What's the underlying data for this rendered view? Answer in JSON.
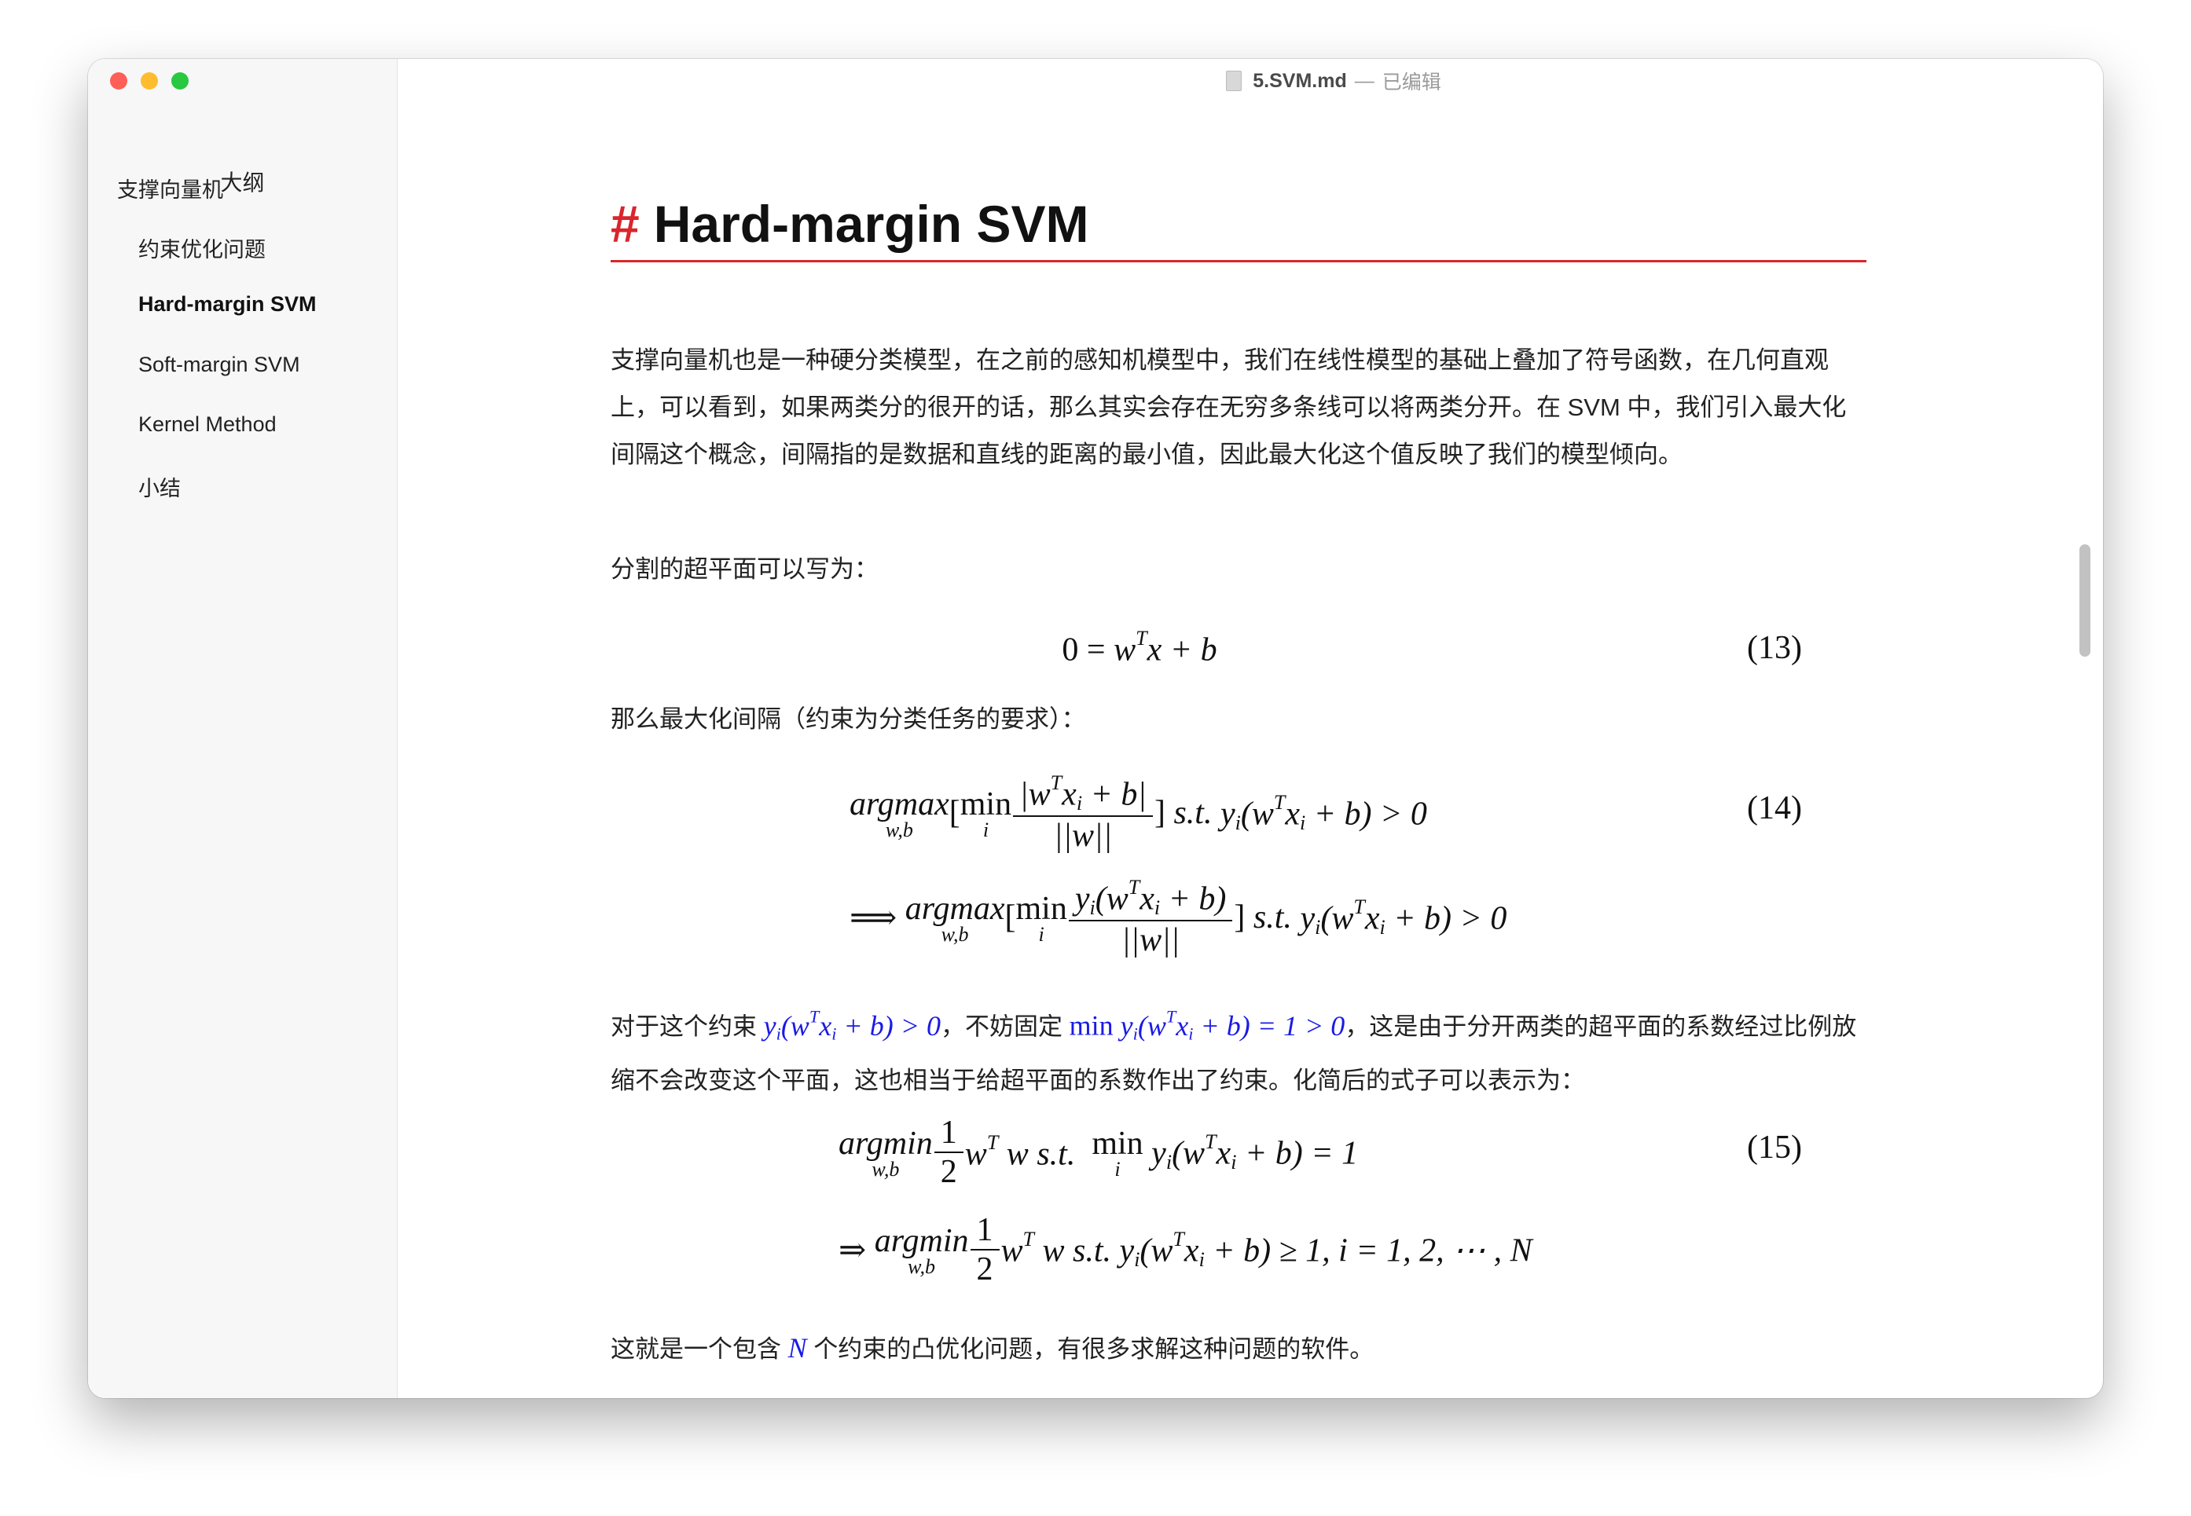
{
  "window": {
    "file_name": "5.SVM.md",
    "separator": "—",
    "status": "已编辑",
    "doc_icon": "document-icon"
  },
  "traffic_lights": {
    "close": "#fe5f57",
    "minimize": "#febc2e",
    "zoom": "#28c840"
  },
  "sidebar": {
    "title": "大纲",
    "items": [
      {
        "label": "支撑向量机",
        "level": 1,
        "active": false
      },
      {
        "label": "约束优化问题",
        "level": 2,
        "active": false
      },
      {
        "label": "Hard-margin SVM",
        "level": 2,
        "active": true
      },
      {
        "label": "Soft-margin SVM",
        "level": 2,
        "active": false
      },
      {
        "label": "Kernel Method",
        "level": 2,
        "active": false
      },
      {
        "label": "小结",
        "level": 2,
        "active": false
      }
    ]
  },
  "content": {
    "heading_hash": "#",
    "heading": "Hard-margin SVM",
    "accent_color": "#d9262c",
    "para1": "支撑向量机也是一种硬分类模型，在之前的感知机模型中，我们在线性模型的基础上叠加了符号函数，在几何直观上，可以看到，如果两类分的很开的话，那么其实会存在无穷多条线可以将两类分开。在 SVM 中，我们引入最大化间隔这个概念，间隔指的是数据和直线的距离的最小值，因此最大化这个值反映了我们的模型倾向。",
    "para2": "分割的超平面可以写为：",
    "eq13": {
      "a": "0 = ",
      "w": "w",
      "T": "T",
      "rest": "x + b",
      "num": "(13)"
    },
    "para3": "那么最大化间隔（约束为分类任务的要求）：",
    "eq14": {
      "argmax": "argmax",
      "wb": "w,b",
      "lb": "[",
      "min": "min",
      "i": "i",
      "num1": "|w",
      "T": "T",
      "num1b": "x",
      "sub_i": "i",
      "num1c": " + b|",
      "den": "||w||",
      "rb": "]",
      "st": "s.t.",
      "y": "y",
      "cons_a": "(w",
      "cons_b": "x",
      "cons_c": " + b) > 0",
      "implies": "⟹",
      "num2a": "(w",
      "num2c": " + b)",
      "eqnum": "(14)"
    },
    "para4_pre": "对于这个约束 ",
    "para4_math1": {
      "y": "y",
      "i": "i",
      "a": "(w",
      "T": "T",
      "x": "x",
      "b": " + b) > 0"
    },
    "para4_mid": "，不妨固定 ",
    "para4_math2": {
      "min": "min ",
      "y": "y",
      "i": "i",
      "a": "(w",
      "T": "T",
      "x": "x",
      "b": " + b) = 1 > 0"
    },
    "para4_post": "，这是由于分开两类的超平面的系数经过比例放缩不会改变这个平面，这也相当于给超平面的系数作出了约束。化简后的式子可以表示为：",
    "eq15": {
      "argmin": "argmin",
      "wb": "w,b",
      "one": "1",
      "two": "2",
      "w": "w",
      "T": "T",
      "w2": " w ",
      "st": "s.t.",
      "min": "min",
      "i": "i",
      "y": "y",
      "a": "(w",
      "x": "x",
      "b1": " + b) = 1",
      "implies": "⇒",
      "b2": " + b) ≥ 1, i = 1, 2, ⋯ , N",
      "eqnum": "(15)"
    },
    "para5_pre": "这就是一个包含 ",
    "para5_N": "N",
    "para5_post": " 个约束的凸优化问题，有很多求解这种问题的软件。"
  }
}
